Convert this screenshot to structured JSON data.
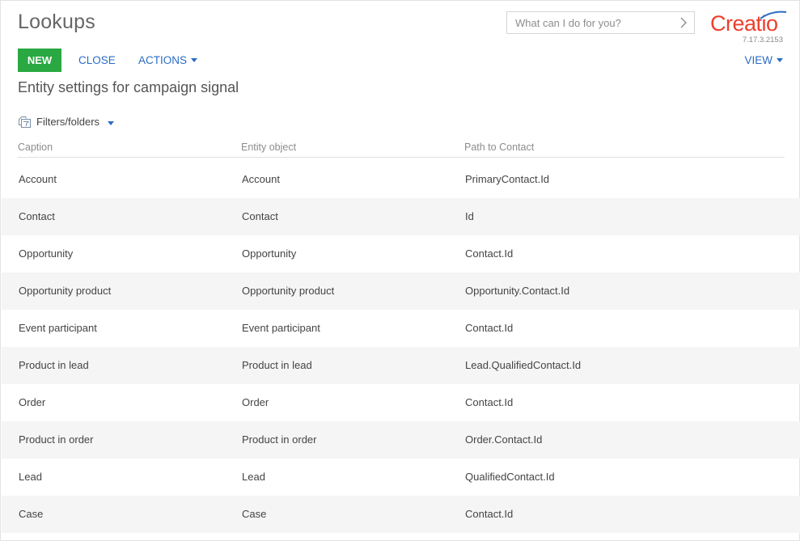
{
  "header": {
    "title": "Lookups",
    "search_placeholder": "What can I do for you?",
    "logo_text": "Creatio",
    "version": "7.17.3.2153"
  },
  "toolbar": {
    "new_label": "NEW",
    "close_label": "CLOSE",
    "actions_label": "ACTIONS",
    "view_label": "VIEW"
  },
  "section_title": "Entity settings for campaign signal",
  "filters_label": "Filters/folders",
  "columns": [
    "Caption",
    "Entity object",
    "Path to Contact"
  ],
  "rows": [
    [
      "Account",
      "Account",
      "PrimaryContact.Id"
    ],
    [
      "Contact",
      "Contact",
      "Id"
    ],
    [
      "Opportunity",
      "Opportunity",
      "Contact.Id"
    ],
    [
      "Opportunity product",
      "Opportunity product",
      "Opportunity.Contact.Id"
    ],
    [
      "Event participant",
      "Event participant",
      "Contact.Id"
    ],
    [
      "Product in lead",
      "Product in lead",
      "Lead.QualifiedContact.Id"
    ],
    [
      "Order",
      "Order",
      "Contact.Id"
    ],
    [
      "Product in order",
      "Product in order",
      "Order.Contact.Id"
    ],
    [
      "Lead",
      "Lead",
      "QualifiedContact.Id"
    ],
    [
      "Case",
      "Case",
      "Contact.Id"
    ]
  ],
  "colors": {
    "accent": "#2b6cc4",
    "new_button": "#2aa842",
    "brand": "#ee3e2d",
    "row_stripe": "#f5f5f5"
  },
  "icons": {
    "search_go": "chevron-right-icon",
    "filters": "folder-filter-icon",
    "dropdown": "caret-down-icon"
  }
}
